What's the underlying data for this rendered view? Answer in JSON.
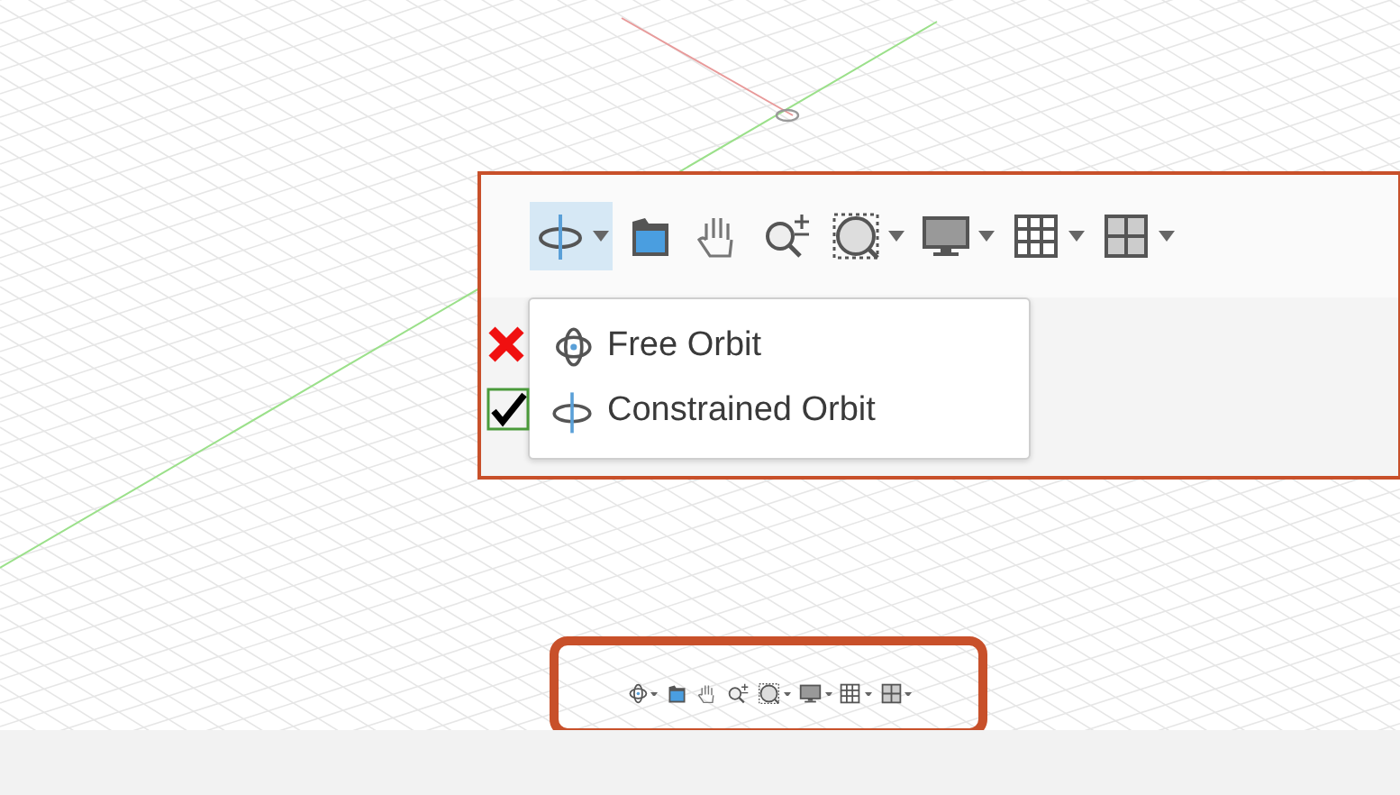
{
  "callout": {
    "toolbar": [
      {
        "kind": "constrained-orbit",
        "dropdown": true,
        "selected": true
      },
      {
        "kind": "look-at",
        "dropdown": false,
        "selected": false
      },
      {
        "kind": "pan",
        "dropdown": false,
        "selected": false
      },
      {
        "kind": "zoom",
        "dropdown": false,
        "selected": false
      },
      {
        "kind": "fit",
        "dropdown": true,
        "selected": false
      },
      {
        "kind": "display",
        "dropdown": true,
        "selected": false
      },
      {
        "kind": "grid",
        "dropdown": true,
        "selected": false
      },
      {
        "kind": "viewports",
        "dropdown": true,
        "selected": false
      }
    ],
    "menu": [
      {
        "label": "Free Orbit",
        "kind": "free-orbit",
        "checked": false
      },
      {
        "label": "Constrained Orbit",
        "kind": "constrained-orbit",
        "checked": true
      }
    ]
  },
  "navbar": {
    "toolbar": [
      {
        "kind": "free-orbit",
        "dropdown": true,
        "selected": false
      },
      {
        "kind": "look-at",
        "dropdown": false,
        "selected": false
      },
      {
        "kind": "pan",
        "dropdown": false,
        "selected": false
      },
      {
        "kind": "zoom",
        "dropdown": false,
        "selected": false
      },
      {
        "kind": "fit",
        "dropdown": true,
        "selected": false
      },
      {
        "kind": "display",
        "dropdown": true,
        "selected": false
      },
      {
        "kind": "grid",
        "dropdown": true,
        "selected": false
      },
      {
        "kind": "viewports",
        "dropdown": true,
        "selected": false
      }
    ]
  }
}
